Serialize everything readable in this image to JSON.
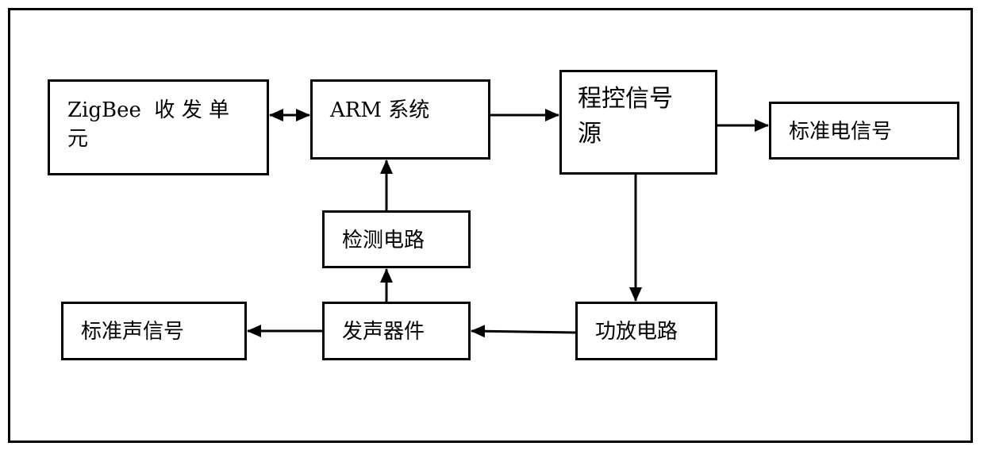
{
  "diagram": {
    "blocks": {
      "zigbee": {
        "label": "ZigBee  收 发 单\n元"
      },
      "arm": {
        "label": "ARM 系统"
      },
      "signal_source": {
        "label": "程控信号\n源"
      },
      "std_electric": {
        "label": "标准电信号"
      },
      "detect": {
        "label": "检测电路"
      },
      "speaker": {
        "label": "发声器件"
      },
      "amplifier": {
        "label": "功放电路"
      },
      "std_sound": {
        "label": "标准声信号"
      }
    },
    "connections": [
      {
        "from": "zigbee",
        "to": "arm",
        "bidirectional": true
      },
      {
        "from": "arm",
        "to": "signal_source",
        "bidirectional": false
      },
      {
        "from": "signal_source",
        "to": "std_electric",
        "bidirectional": false
      },
      {
        "from": "signal_source",
        "to": "amplifier",
        "bidirectional": false
      },
      {
        "from": "amplifier",
        "to": "speaker",
        "bidirectional": false
      },
      {
        "from": "speaker",
        "to": "std_sound",
        "bidirectional": false
      },
      {
        "from": "speaker",
        "to": "detect",
        "bidirectional": false
      },
      {
        "from": "detect",
        "to": "arm",
        "bidirectional": false
      }
    ]
  }
}
